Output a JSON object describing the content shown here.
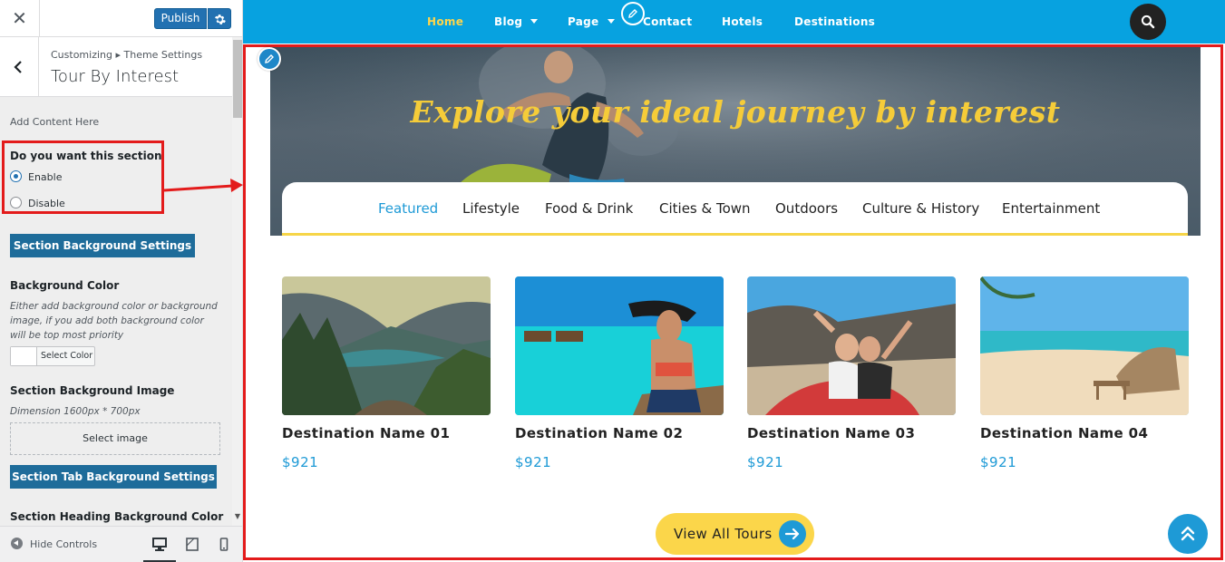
{
  "customizer": {
    "close_glyph": "✕",
    "publish_label": "Publish",
    "breadcrumb": "Customizing ▸ Theme Settings",
    "section_title": "Tour By Interest",
    "add_content_text": "Add Content Here",
    "section_toggle": {
      "label": "Do you want this section",
      "options": [
        "Enable",
        "Disable"
      ],
      "selected": "Enable"
    },
    "section_bg_button": "Section Background Settings",
    "bg_color": {
      "label": "Background Color",
      "description": "Either add background color or background image, if you add both background color will be top most priority",
      "picker_label": "Select Color"
    },
    "bg_image": {
      "label": "Section Background Image",
      "dimension": "Dimension 1600px * 700px",
      "button": "Select image"
    },
    "tab_bg_button": "Section Tab Background Settings",
    "heading_bg_label": "Section Heading Background Color",
    "footer": {
      "hide_controls": "Hide Controls",
      "devices": [
        "desktop-icon",
        "tablet-icon",
        "mobile-icon"
      ],
      "active_device": "desktop"
    }
  },
  "preview": {
    "nav": {
      "items": [
        "Home",
        "Blog",
        "Page",
        "Contact",
        "Hotels",
        "Destinations"
      ],
      "active": "Home",
      "dropdowns": [
        "Blog",
        "Page"
      ]
    },
    "hero_title": "Explore your ideal journey by interest",
    "tabs": [
      "Featured",
      "Lifestyle",
      "Food & Drink",
      "Cities & Town",
      "Outdoors",
      "Culture & History",
      "Entertainment"
    ],
    "active_tab": "Featured",
    "cards": [
      {
        "name": "Destination Name 01",
        "price": "$921",
        "image": "mountain-lake-photo"
      },
      {
        "name": "Destination Name 02",
        "price": "$921",
        "image": "tropical-water-bungalow-photo"
      },
      {
        "name": "Destination Name 03",
        "price": "$921",
        "image": "friends-selfie-car-photo"
      },
      {
        "name": "Destination Name 04",
        "price": "$921",
        "image": "beach-lounge-photo"
      }
    ],
    "view_all_label": "View All Tours"
  },
  "colors": {
    "nav_bg": "#07a2e0",
    "nav_active": "#ffd54a",
    "accent_blue": "#1e9ad6",
    "hero_title": "#f5cc39",
    "button_yellow": "#fbd64a",
    "annotation_red": "#e31b1b",
    "wp_blue": "#2271b1"
  }
}
